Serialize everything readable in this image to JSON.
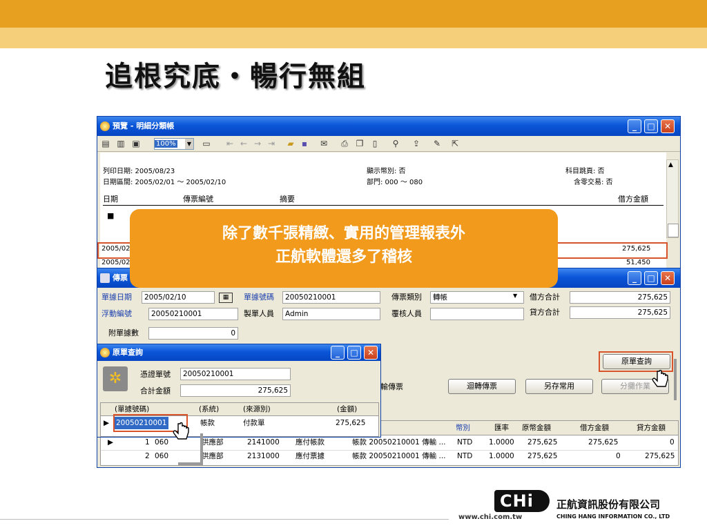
{
  "slide": {
    "title": "追根究底・暢行無組"
  },
  "preview_window": {
    "title": "預覽 - 明細分類帳",
    "zoom": "100%",
    "header": {
      "print_date": "列印日期: 2005/08/23",
      "date_range": "日期區間: 2005/02/01 ～ 2005/02/10",
      "currency": "顯示幣別: 否",
      "dept": "部門: 000 ～ 080",
      "subject_page": "科目跳頁: 否",
      "zero_txn": "含零交易: 否"
    },
    "columns": {
      "date": "日期",
      "voucher": "傳票編號",
      "summary": "摘要",
      "debit": "借方金額"
    },
    "rows": [
      {
        "date": "2005/02",
        "debit": "275,625"
      },
      {
        "date": "2005/02",
        "debit": "51,450"
      }
    ],
    "bullet": "■"
  },
  "callout": {
    "line1": "除了數千張精緻、實用的管理報表外",
    "line2": "正航軟體還多了稽核"
  },
  "voucher_window": {
    "title": "傳票",
    "doc_date_label": "單據日期",
    "doc_date": "2005/02/10",
    "doc_no_label": "單據號碼",
    "doc_no": "20050210001",
    "type_label": "傳票類別",
    "type": "轉帳",
    "debit_total_label": "借方合計",
    "debit_total": "275,625",
    "credit_total_label": "貸方合計",
    "credit_total": "275,625",
    "float_no_label": "浮動編號",
    "float_no": "20050210001",
    "maker_label": "製單人員",
    "maker": "Admin",
    "reviewer_label": "覆核人員",
    "reviewer": "",
    "attach_label": "附單據數",
    "attach": "0",
    "transfer_label": "輸傳票",
    "buttons": {
      "reverse": "迴轉傳票",
      "save_common": "另存常用",
      "split": "分攤作業",
      "orig_query": "原單查詢"
    },
    "grid_headers": {
      "currency": "幣別",
      "rate": "匯率",
      "orig_amt": "原幣金額",
      "debit": "借方金額",
      "credit": "貸方金額"
    },
    "grid_rows": [
      {
        "no": "1",
        "code": "060",
        "dept": "供應部",
        "acct": "2141000",
        "acct_name": "應付帳款",
        "summary": "帳款 20050210001 傳輸 ...",
        "currency": "NTD",
        "rate": "1.0000",
        "orig_amt": "275,625",
        "debit": "275,625",
        "credit": "0"
      },
      {
        "no": "2",
        "code": "060",
        "dept": "供應部",
        "acct": "2131000",
        "acct_name": "應付票據",
        "summary": "帳款 20050210001 傳輸 ...",
        "currency": "NTD",
        "rate": "1.0000",
        "orig_amt": "275,625",
        "debit": "0",
        "credit": "275,625"
      }
    ]
  },
  "orig_window": {
    "title": "原單查詢",
    "voucher_no_label": "憑證單號",
    "voucher_no": "20050210001",
    "total_label": "合計金額",
    "total": "275,625",
    "headers": {
      "doc_no": "(單據號碼)",
      "system": "(系統)",
      "source": "(來源別)",
      "amount": "(金額)"
    },
    "row": {
      "doc_no": "20050210001",
      "system": "帳款",
      "source": "付款單",
      "amount": "275,625"
    }
  },
  "footer": {
    "brand_mark": "CHi",
    "url": "www.chi.com.tw",
    "company_cn": "正航資訊股份有限公司",
    "company_en": "CHING HANG INFORMATION CO., LTD"
  }
}
